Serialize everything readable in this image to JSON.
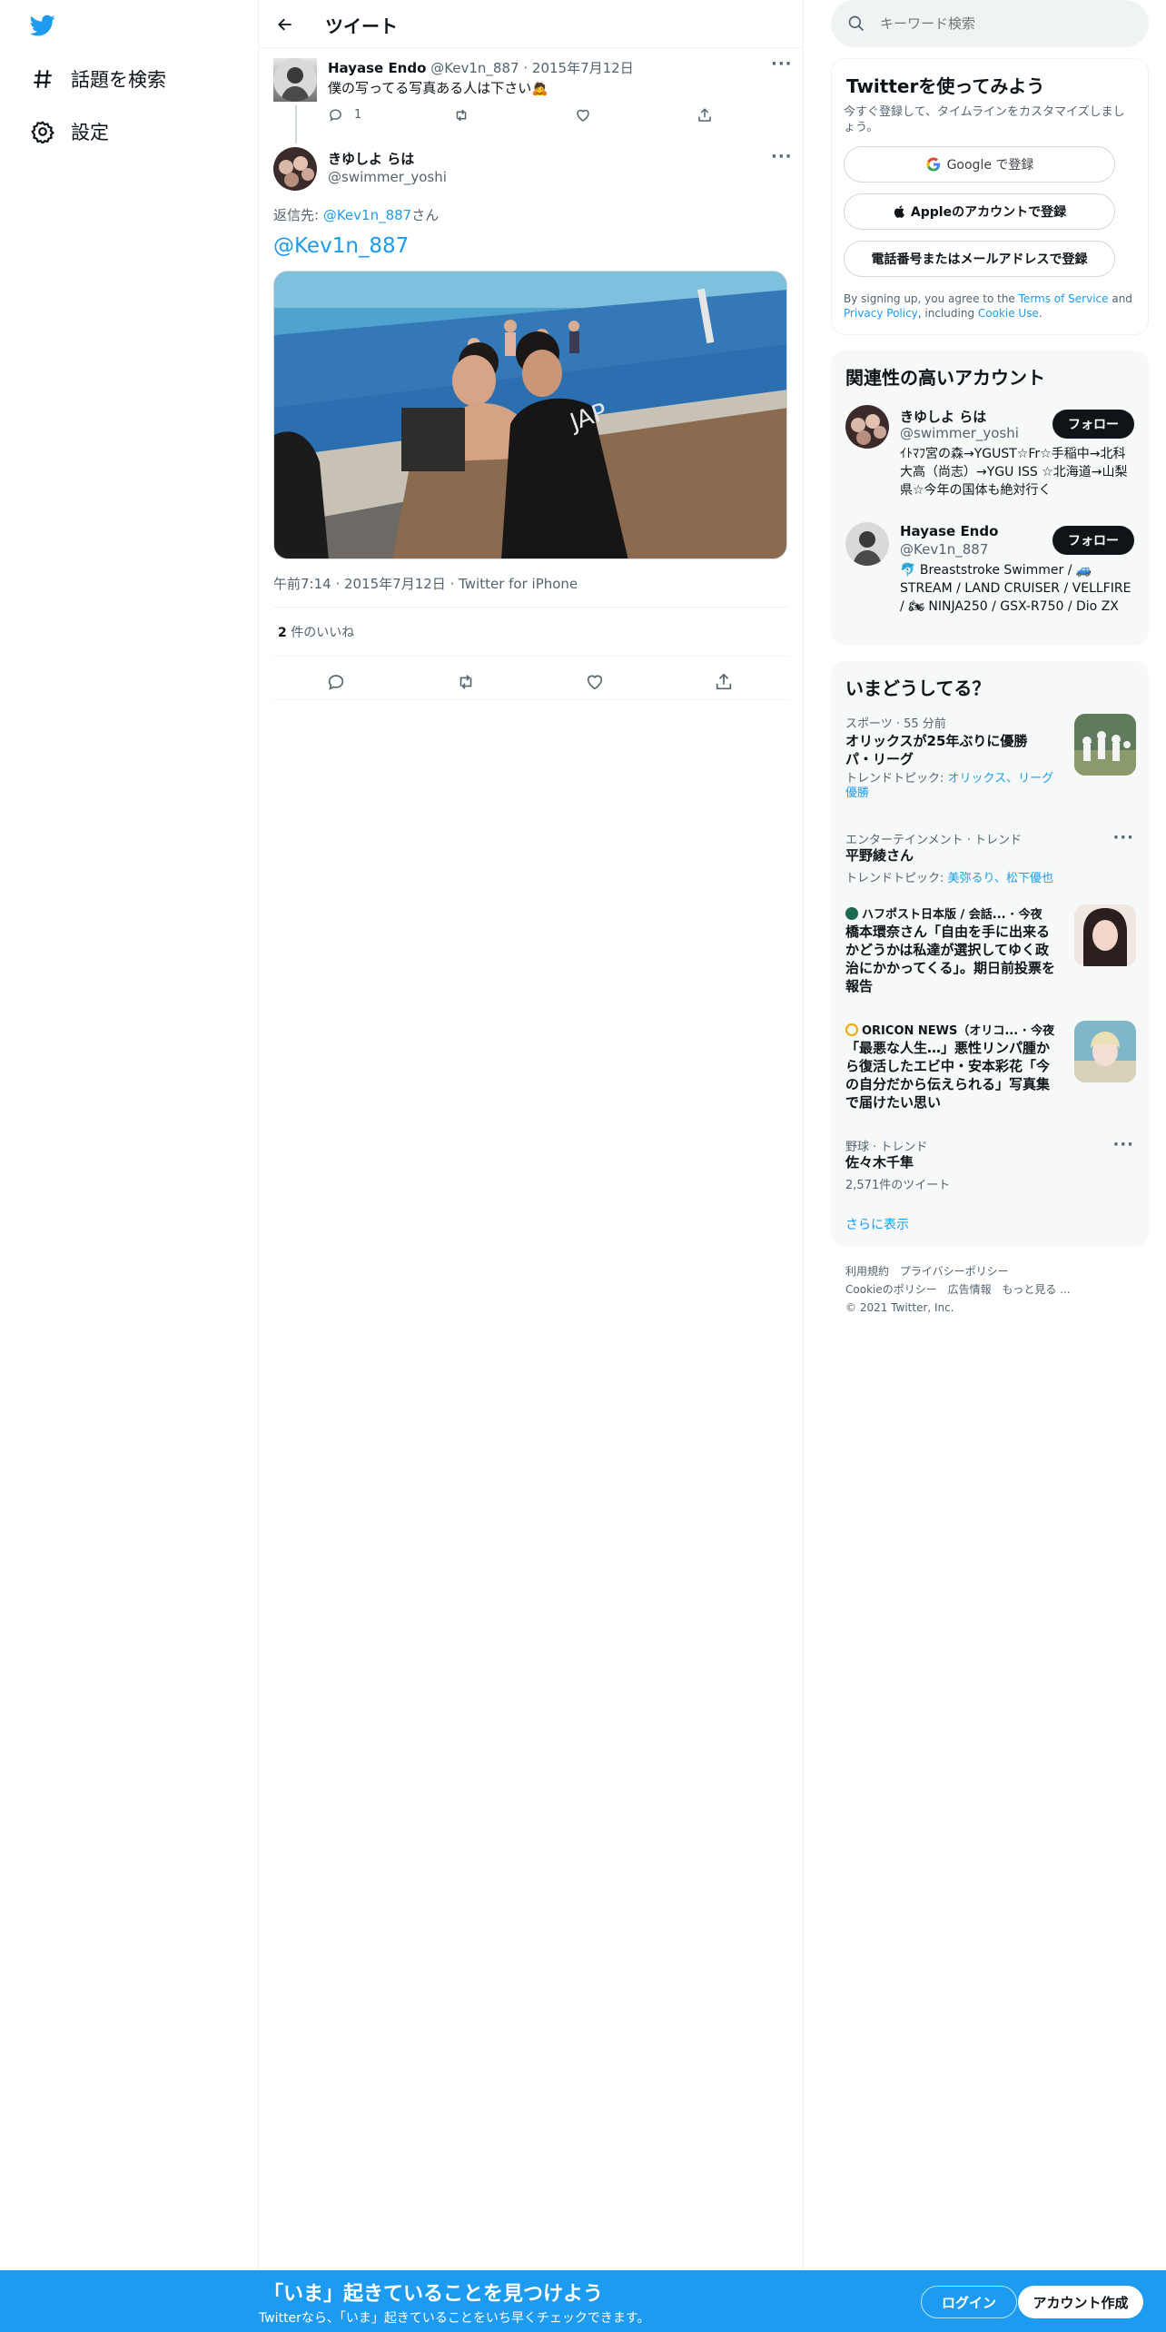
{
  "nav": {
    "explore_label": "話題を検索",
    "settings_label": "設定"
  },
  "header": {
    "title": "ツイート"
  },
  "parent_tweet": {
    "name": "Hayase Endo",
    "handle": "@Kev1n_887",
    "dot": "·",
    "date": "2015年7月12日",
    "text": "僕の写ってる写真ある人は下さい🙇",
    "reply_count": "1"
  },
  "main_tweet": {
    "name": "きゆしよ らは",
    "handle": "@swimmer_yoshi",
    "reply_to_prefix": "返信先: ",
    "reply_to_handle": "@Kev1n_887",
    "reply_to_suffix": "さん",
    "text": "@Kev1n_887",
    "timestamp": "午前7:14 · 2015年7月12日 · Twitter for iPhone",
    "like_count": "2",
    "like_label": " 件のいいね"
  },
  "search": {
    "placeholder": "キーワード検索"
  },
  "signup": {
    "title": "Twitterを使ってみよう",
    "subtitle": "今すぐ登録して、タイムラインをカスタマイズしましょう。",
    "google_label": "Google で登録",
    "apple_label": "Appleのアカウントで登録",
    "phone_label": "電話番号またはメールアドレスで登録",
    "terms_prefix": "By signing up, you agree to the ",
    "terms_link": "Terms of Service",
    "terms_and": " and ",
    "privacy_link": "Privacy Policy",
    "terms_including": ", including ",
    "cookie_link": "Cookie Use",
    "terms_end": "."
  },
  "related": {
    "title": "関連性の高いアカウント",
    "follow_label": "フォロー",
    "accounts": [
      {
        "name": "きゆしよ らは",
        "handle": "@swimmer_yoshi",
        "bio": "ｲﾄﾏﾌ宮の森→YGUST☆Fr☆手稲中→北科大高（尚志）→YGU ISS ☆北海道→山梨県☆今年の国体も絶対行く"
      },
      {
        "name": "Hayase Endo",
        "handle": "@Kev1n_887",
        "bio": "🐬 Breaststroke Swimmer / 🚙 STREAM / LAND CRUISER / VELLFIRE / 🏍 NINJA250 / GSX-R750 / Dio ZX"
      }
    ]
  },
  "trends": {
    "title": "いまどうしてる？",
    "items": [
      {
        "meta": "スポーツ · 55 分前",
        "title": "オリックスが25年ぶりに優勝 パ・リーグ",
        "topic_prefix": "トレンドトピック: ",
        "topic": "オリックス、リーグ優勝"
      },
      {
        "meta": "エンターテインメント · トレンド",
        "title": "平野綾さん",
        "topic_prefix": "トレンドトピック: ",
        "topic": "美弥るり、松下優也"
      },
      {
        "meta": "ハフポスト日本版 / 会話... · 今夜",
        "title": "橋本環奈さん「自由を手に出来るかどうかは私達が選択してゆく政治にかかってくる」。期日前投票を報告"
      },
      {
        "meta": "ORICON NEWS（オリコ... · 今夜",
        "title": "「最悪な人生…」悪性リンパ腫から復活したエビ中・安本彩花「今の自分だから伝えられる」写真集で届けたい思い"
      },
      {
        "meta": "野球 · トレンド",
        "title": "佐々木千隼",
        "count": "2,571件のツイート"
      }
    ],
    "show_more": "さらに表示"
  },
  "footer": {
    "tos": "利用規約",
    "privacy": "プライバシーポリシー",
    "cookie": "Cookieのポリシー",
    "ads": "広告情報",
    "more": "もっと見る ...",
    "copyright": "© 2021 Twitter, Inc."
  },
  "bottom_bar": {
    "title": "「いま」起きていることを見つけよう",
    "subtitle": "Twitterなら、「いま」起きていることをいち早くチェックできます。",
    "login_label": "ログイン",
    "signup_label": "アカウント作成"
  },
  "colors": {
    "brand": "#1d9bf0",
    "text": "#0f1419",
    "muted": "#536471"
  }
}
